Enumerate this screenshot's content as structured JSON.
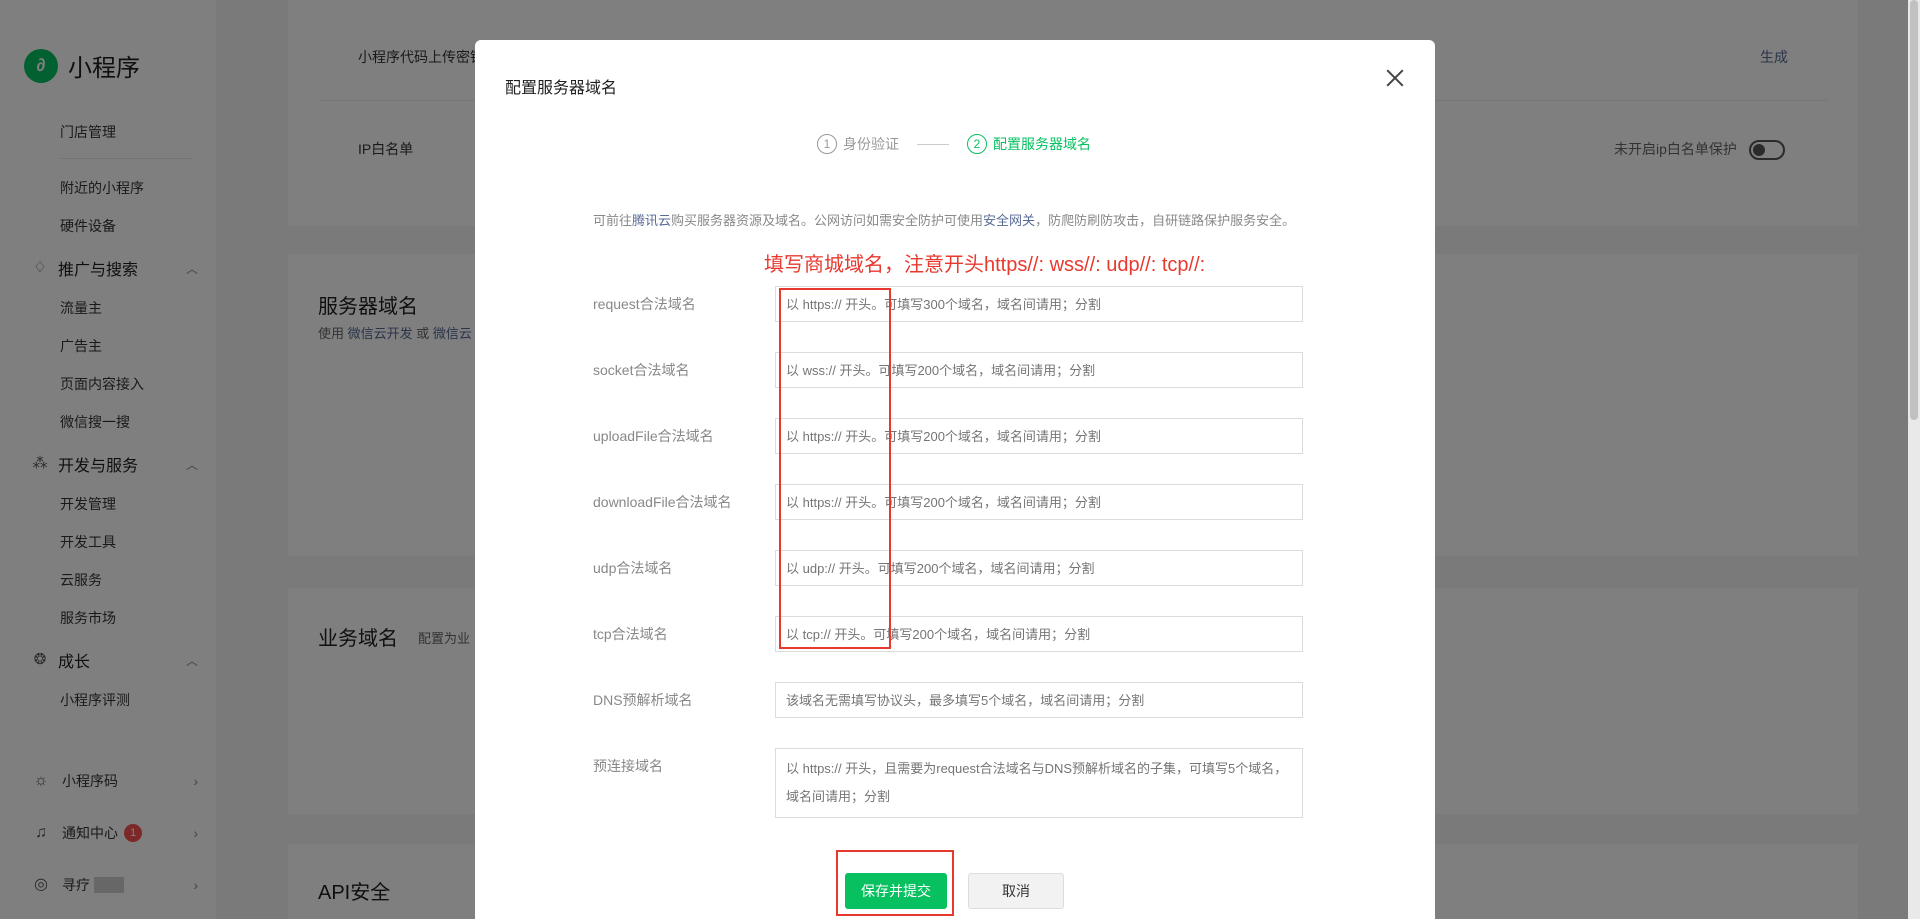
{
  "sidebar": {
    "logo_text": "小程序",
    "items_top": [
      "门店管理",
      "附近的小程序",
      "硬件设备"
    ],
    "groups": [
      {
        "title": "推广与搜索",
        "icon": "flame-icon",
        "items": [
          "流量主",
          "广告主",
          "页面内容接入",
          "微信搜一搜"
        ]
      },
      {
        "title": "开发与服务",
        "icon": "cluster-icon",
        "items": [
          "开发管理",
          "开发工具",
          "云服务",
          "服务市场"
        ]
      },
      {
        "title": "成长",
        "icon": "growth-icon",
        "items": [
          "小程序评测"
        ]
      }
    ],
    "bottom": [
      {
        "label": "小程序码",
        "icon": "sun-icon"
      },
      {
        "label": "通知中心",
        "icon": "bell-icon",
        "badge": "1"
      },
      {
        "label": "寻疗",
        "icon": "account-icon"
      }
    ]
  },
  "background": {
    "row1_label": "小程序代码上传密钥",
    "row1_action": "生成",
    "row2_label": "IP白名单",
    "row2_status": "未开启ip白名单保护",
    "server_title": "服务器域名",
    "server_sub_prefix": "使用",
    "server_sub_link1": "微信云开发",
    "server_sub_or": "或",
    "server_sub_link2": "微信云",
    "business_title": "业务域名",
    "business_sub": "配置为业",
    "api_title": "API安全"
  },
  "modal": {
    "title": "配置服务器域名",
    "steps": [
      {
        "num": "1",
        "label": "身份验证"
      },
      {
        "num": "2",
        "label": "配置服务器域名"
      }
    ],
    "intro_1": "可前往",
    "intro_link1": "腾讯云",
    "intro_2": "购买服务器资源及域名。公网访问如需安全防护可使用",
    "intro_link2": "安全网关",
    "intro_3": "，防爬防刷防攻击，自研链路保护服务安全。",
    "annotation": "填写商城域名，注意开头https//:  wss//:  udp//:   tcp//:",
    "fields": [
      {
        "label": "request合法域名",
        "placeholder": "以 https:// 开头。可填写300个域名，域名间请用；分割"
      },
      {
        "label": "socket合法域名",
        "placeholder": "以 wss:// 开头。可填写200个域名，域名间请用；分割"
      },
      {
        "label": "uploadFile合法域名",
        "placeholder": "以 https:// 开头。可填写200个域名，域名间请用；分割"
      },
      {
        "label": "downloadFile合法域名",
        "placeholder": "以 https:// 开头。可填写200个域名，域名间请用；分割"
      },
      {
        "label": "udp合法域名",
        "placeholder": "以 udp:// 开头。可填写200个域名，域名间请用；分割"
      },
      {
        "label": "tcp合法域名",
        "placeholder": "以 tcp:// 开头。可填写200个域名，域名间请用；分割"
      },
      {
        "label": "DNS预解析域名",
        "placeholder": "该域名无需填写协议头，最多填写5个域名，域名间请用；分割"
      },
      {
        "label": "预连接域名",
        "placeholder": "以 https:// 开头，且需要为request合法域名与DNS预解析域名的子集，可填写5个域名，域名间请用；分割"
      }
    ],
    "submit_label": "保存并提交",
    "cancel_label": "取消"
  },
  "colors": {
    "brand_green": "#07c160",
    "annotation_red": "#e8392f",
    "link_blue": "#576b95"
  }
}
